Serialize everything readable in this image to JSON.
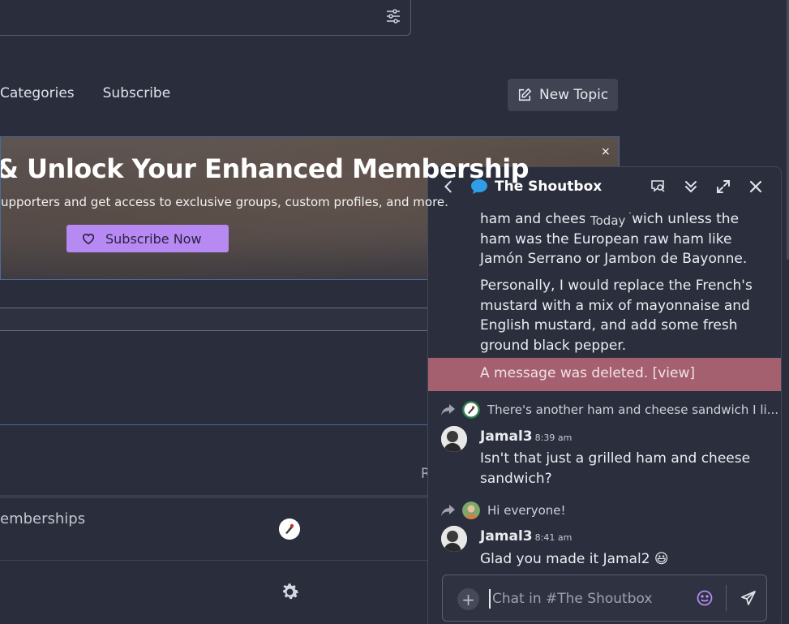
{
  "nav": {
    "items": [
      "Categories",
      "Subscribe"
    ],
    "new_topic": "New Topic"
  },
  "banner": {
    "title": "& Unlock Your Enhanced Membership",
    "subtitle": "upporters and get access to exclusive groups, custom profiles, and more.",
    "cta": "Subscribe Now",
    "close": "×"
  },
  "list": {
    "r_label": "R",
    "memberships": "emberships"
  },
  "shoutbox": {
    "title": "The Shoutbox",
    "day_separator": "Today",
    "messages": [
      {
        "text": "ham and cheese sandwich unless the ham was the European raw ham like Jamón Serrano or Jambon de Bayonne."
      },
      {
        "text": "Personally, I would replace the French's mustard with a mix of mayonnaise and English mustard, and add some fresh ground black pepper."
      }
    ],
    "deleted_notice": "A message was deleted. [view]",
    "reply_1": "There's another ham and cheese sandwich I li...",
    "post_1": {
      "author": "Jamal3",
      "time": "8:39 am",
      "text": "Isn't that just a grilled ham and cheese sandwich?"
    },
    "reply_2": "Hi everyone!",
    "post_2": {
      "author": "Jamal3",
      "time": "8:41 am",
      "text": "Glad you made it Jamal2 😃"
    },
    "composer": {
      "placeholder": "Chat in #The Shoutbox",
      "value": ""
    }
  },
  "colors": {
    "accent": "#b68af2",
    "deleted_bg": "#a56070",
    "chat_icon": "#2f9ee8",
    "background": "#2a2d3b"
  },
  "icons": [
    "filter-icon",
    "edit-icon",
    "heart-icon",
    "gear-icon",
    "back-icon",
    "chat-bubble-icon",
    "search-messages-icon",
    "jump-bottom-icon",
    "expand-icon",
    "close-icon",
    "reply-arrow-icon",
    "plus-icon",
    "emoji-icon",
    "send-icon"
  ]
}
